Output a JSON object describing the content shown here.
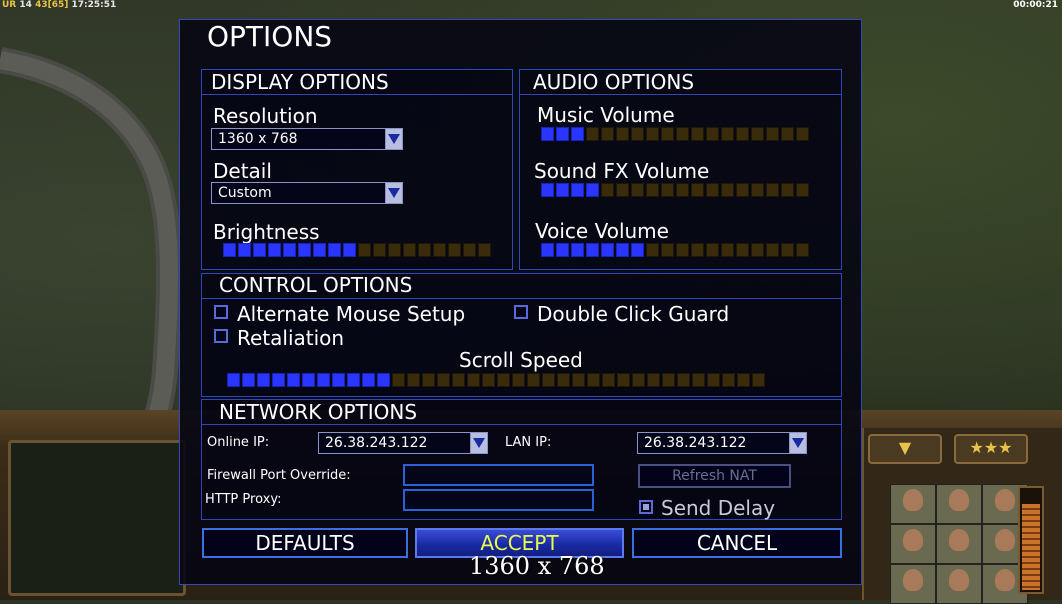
{
  "hud": {
    "left_prefix": "UR",
    "left_a": "14",
    "left_b": "43",
    "left_c": "[65]",
    "left_time": "17:25:51",
    "right_time": "00:00:21"
  },
  "dialog": {
    "title": "OPTIONS",
    "display": {
      "title": "DISPLAY OPTIONS",
      "resolution_label": "Resolution",
      "resolution_value": "1360 x 768",
      "detail_label": "Detail",
      "detail_value": "Custom",
      "brightness_label": "Brightness",
      "brightness_level": 9,
      "brightness_total": 18
    },
    "audio": {
      "title": "AUDIO OPTIONS",
      "music_label": "Music Volume",
      "music_level": 3,
      "music_total": 18,
      "sfx_label": "Sound FX Volume",
      "sfx_level": 4,
      "sfx_total": 18,
      "voice_label": "Voice Volume",
      "voice_level": 7,
      "voice_total": 18
    },
    "control": {
      "title": "CONTROL OPTIONS",
      "alt_mouse_label": "Alternate Mouse Setup",
      "alt_mouse_checked": false,
      "double_click_label": "Double Click Guard",
      "double_click_checked": false,
      "retaliation_label": "Retaliation",
      "retaliation_checked": false,
      "scroll_label": "Scroll Speed",
      "scroll_level": 11,
      "scroll_total": 36
    },
    "network": {
      "title": "NETWORK OPTIONS",
      "online_ip_label": "Online IP:",
      "online_ip_value": "26.38.243.122",
      "lan_ip_label": "LAN IP:",
      "lan_ip_value": "26.38.243.122",
      "firewall_label": "Firewall Port Override:",
      "firewall_value": "",
      "http_proxy_label": "HTTP Proxy:",
      "http_proxy_value": "",
      "refresh_nat_label": "Refresh NAT",
      "send_delay_label": "Send Delay",
      "send_delay_checked": true
    },
    "buttons": {
      "defaults": "DEFAULTS",
      "accept": "ACCEPT",
      "cancel": "CANCEL"
    },
    "tooltip": "1360 x 768"
  },
  "colors": {
    "panel_border": "#2f47b8",
    "slider_on": "#2a36ff",
    "slider_off": "#3a2c0a",
    "accept_text": "#e8ff4a"
  },
  "right_panel": {
    "tab_left_icon": "chevron-down-icon",
    "tab_right_icon": "rank-stars-icon",
    "tab_right_text": "★★★"
  }
}
